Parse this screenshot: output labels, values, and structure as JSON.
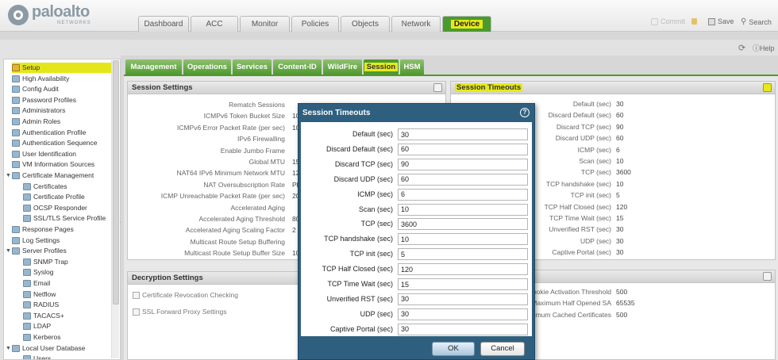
{
  "brand": {
    "name": "paloalto",
    "sub": "NETWORKS"
  },
  "nav": {
    "tabs": [
      "Dashboard",
      "ACC",
      "Monitor",
      "Policies",
      "Objects",
      "Network",
      "Device"
    ],
    "active": "Device"
  },
  "topright": {
    "commit": "Commit",
    "save": "Save",
    "search": "Search"
  },
  "help": "Help",
  "sidebar": {
    "items": [
      {
        "label": "Setup",
        "level": 1,
        "selected": true
      },
      {
        "label": "High Availability",
        "level": 1
      },
      {
        "label": "Config Audit",
        "level": 1
      },
      {
        "label": "Password Profiles",
        "level": 1
      },
      {
        "label": "Administrators",
        "level": 1
      },
      {
        "label": "Admin Roles",
        "level": 1
      },
      {
        "label": "Authentication Profile",
        "level": 1
      },
      {
        "label": "Authentication Sequence",
        "level": 1
      },
      {
        "label": "User Identification",
        "level": 1
      },
      {
        "label": "VM Information Sources",
        "level": 1
      },
      {
        "label": "Certificate Management",
        "level": 0,
        "expand": "▼"
      },
      {
        "label": "Certificates",
        "level": 2
      },
      {
        "label": "Certificate Profile",
        "level": 2
      },
      {
        "label": "OCSP Responder",
        "level": 2
      },
      {
        "label": "SSL/TLS Service Profile",
        "level": 2
      },
      {
        "label": "Response Pages",
        "level": 1
      },
      {
        "label": "Log Settings",
        "level": 1
      },
      {
        "label": "Server Profiles",
        "level": 0,
        "expand": "▼"
      },
      {
        "label": "SNMP Trap",
        "level": 2
      },
      {
        "label": "Syslog",
        "level": 2
      },
      {
        "label": "Email",
        "level": 2
      },
      {
        "label": "Netflow",
        "level": 2
      },
      {
        "label": "RADIUS",
        "level": 2
      },
      {
        "label": "TACACS+",
        "level": 2
      },
      {
        "label": "LDAP",
        "level": 2
      },
      {
        "label": "Kerberos",
        "level": 2
      },
      {
        "label": "Local User Database",
        "level": 0,
        "expand": "▼"
      },
      {
        "label": "Users",
        "level": 2
      }
    ]
  },
  "subtabs": {
    "items": [
      "Management",
      "Operations",
      "Services",
      "Content-ID",
      "WildFire",
      "Session",
      "HSM"
    ],
    "active": "Session"
  },
  "session_settings": {
    "title": "Session Settings",
    "rows": [
      {
        "label": "Rematch Sessions",
        "value": ""
      },
      {
        "label": "ICMPv6 Token Bucket Size",
        "value": "10"
      },
      {
        "label": "ICMPv6 Error Packet Rate (per sec)",
        "value": "10"
      },
      {
        "label": "IPv6 Firewalling",
        "value": ""
      },
      {
        "label": "Enable Jumbo Frame",
        "value": ""
      },
      {
        "label": "Global MTU",
        "value": "15"
      },
      {
        "label": "NAT64 IPv6 Minimum Network MTU",
        "value": "12"
      },
      {
        "label": "NAT Oversubscription Rate",
        "value": "Pl"
      },
      {
        "label": "ICMP Unreachable Packet Rate (per sec)",
        "value": "20"
      },
      {
        "label": "Accelerated Aging",
        "value": ""
      },
      {
        "label": "Accelerated Aging Threshold",
        "value": "80"
      },
      {
        "label": "Accelerated Aging Scaling Factor",
        "value": "2"
      },
      {
        "label": "Multicast Route Setup Buffering",
        "value": ""
      },
      {
        "label": "Multicast Route Setup Buffer Size",
        "value": "10"
      }
    ]
  },
  "session_timeouts": {
    "title": "Session Timeouts",
    "rows": [
      {
        "label": "Default (sec)",
        "value": "30"
      },
      {
        "label": "Discard Default (sec)",
        "value": "60"
      },
      {
        "label": "Discard TCP (sec)",
        "value": "90"
      },
      {
        "label": "Discard UDP (sec)",
        "value": "60"
      },
      {
        "label": "ICMP (sec)",
        "value": "6"
      },
      {
        "label": "Scan (sec)",
        "value": "10"
      },
      {
        "label": "TCP (sec)",
        "value": "3600"
      },
      {
        "label": "TCP handshake (sec)",
        "value": "10"
      },
      {
        "label": "TCP init (sec)",
        "value": "5"
      },
      {
        "label": "TCP Half Closed (sec)",
        "value": "120"
      },
      {
        "label": "TCP Time Wait (sec)",
        "value": "15"
      },
      {
        "label": "Unverified RST (sec)",
        "value": "30"
      },
      {
        "label": "UDP (sec)",
        "value": "30"
      },
      {
        "label": "Captive Portal (sec)",
        "value": "30"
      }
    ]
  },
  "decryption_settings": {
    "title": "Decryption Settings",
    "links": [
      "Certificate Revocation Checking",
      "SSL Forward Proxy Settings"
    ]
  },
  "syn_panel": {
    "rows": [
      {
        "label": "ookie Activation Threshold",
        "value": "500"
      },
      {
        "label": "Maximum Half Opened SA",
        "value": "65535"
      },
      {
        "label": "ximum Cached Certificates",
        "value": "500"
      }
    ]
  },
  "dialog": {
    "title": "Session Timeouts",
    "fields": [
      {
        "label": "Default (sec)",
        "value": "30"
      },
      {
        "label": "Discard Default (sec)",
        "value": "60"
      },
      {
        "label": "Discard TCP (sec)",
        "value": "90"
      },
      {
        "label": "Discard UDP (sec)",
        "value": "60"
      },
      {
        "label": "ICMP (sec)",
        "value": "6"
      },
      {
        "label": "Scan (sec)",
        "value": "10"
      },
      {
        "label": "TCP (sec)",
        "value": "3600"
      },
      {
        "label": "TCP handshake (sec)",
        "value": "10"
      },
      {
        "label": "TCP init (sec)",
        "value": "5"
      },
      {
        "label": "TCP Half Closed (sec)",
        "value": "120"
      },
      {
        "label": "TCP Time Wait (sec)",
        "value": "15"
      },
      {
        "label": "Unverified RST (sec)",
        "value": "30"
      },
      {
        "label": "UDP (sec)",
        "value": "30"
      },
      {
        "label": "Captive Portal (sec)",
        "value": "30"
      }
    ],
    "ok": "OK",
    "cancel": "Cancel"
  },
  "colors": {
    "accent": "#4f9a2e",
    "highlight": "#e6ea1a",
    "dialog": "#2f5f7e"
  }
}
